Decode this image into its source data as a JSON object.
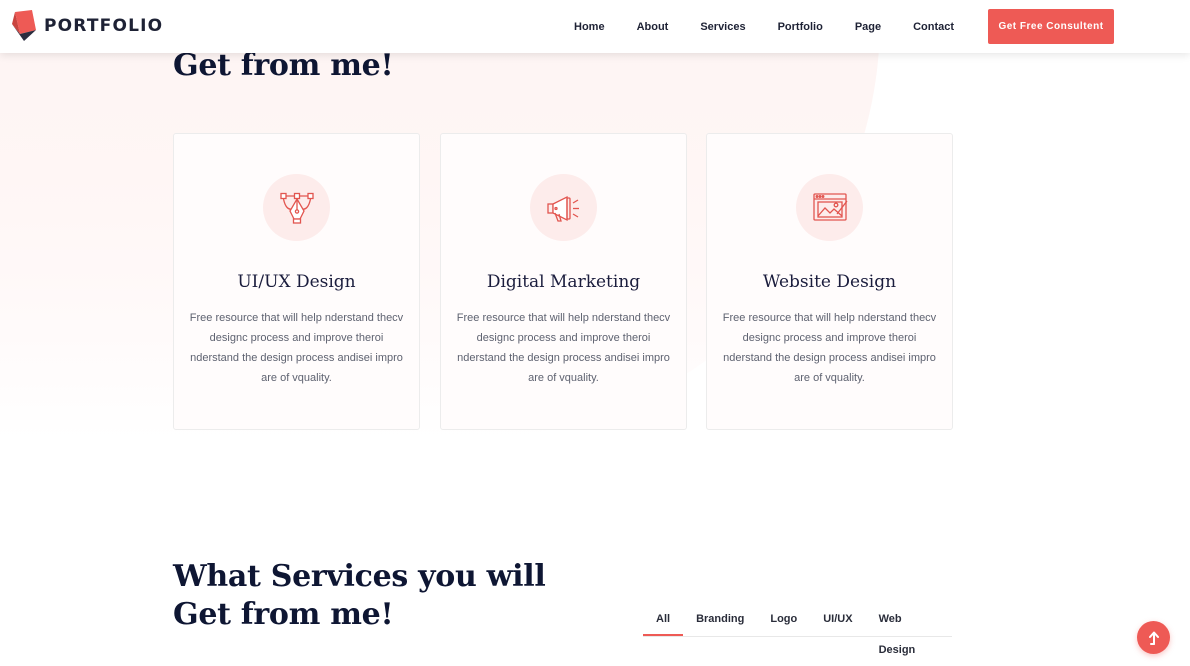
{
  "brand": {
    "name": "PORTFOLIO"
  },
  "nav": {
    "items": [
      "Home",
      "About",
      "Services",
      "Portfolio",
      "Page",
      "Contact"
    ]
  },
  "cta_label": "Get Free Consultent",
  "section_top": {
    "heading": "Get from me!"
  },
  "cards": [
    {
      "title": "UI/UX Design",
      "icon": "pen-tool-icon",
      "desc": "Free resource that will help nderstand thecv designc process and improve theroi nderstand the design process andisei impro are of vquality."
    },
    {
      "title": "Digital Marketing",
      "icon": "megaphone-icon",
      "desc": "Free resource that will help nderstand thecv designc process and improve theroi nderstand the design process andisei impro are of vquality."
    },
    {
      "title": "Website Design",
      "icon": "browser-image-icon",
      "desc": "Free resource that will help nderstand thecv designc process and improve theroi nderstand the design process andisei impro are of vquality."
    }
  ],
  "section_bottom": {
    "heading_line1": "What Services you will",
    "heading_line2": "Get from me!"
  },
  "filter_tabs": [
    "All",
    "Branding",
    "Logo",
    "UI/UX",
    "Web Design"
  ],
  "colors": {
    "accent": "#ee5a55",
    "heading": "#0e1633",
    "icon_bg": "#fdeceb"
  }
}
